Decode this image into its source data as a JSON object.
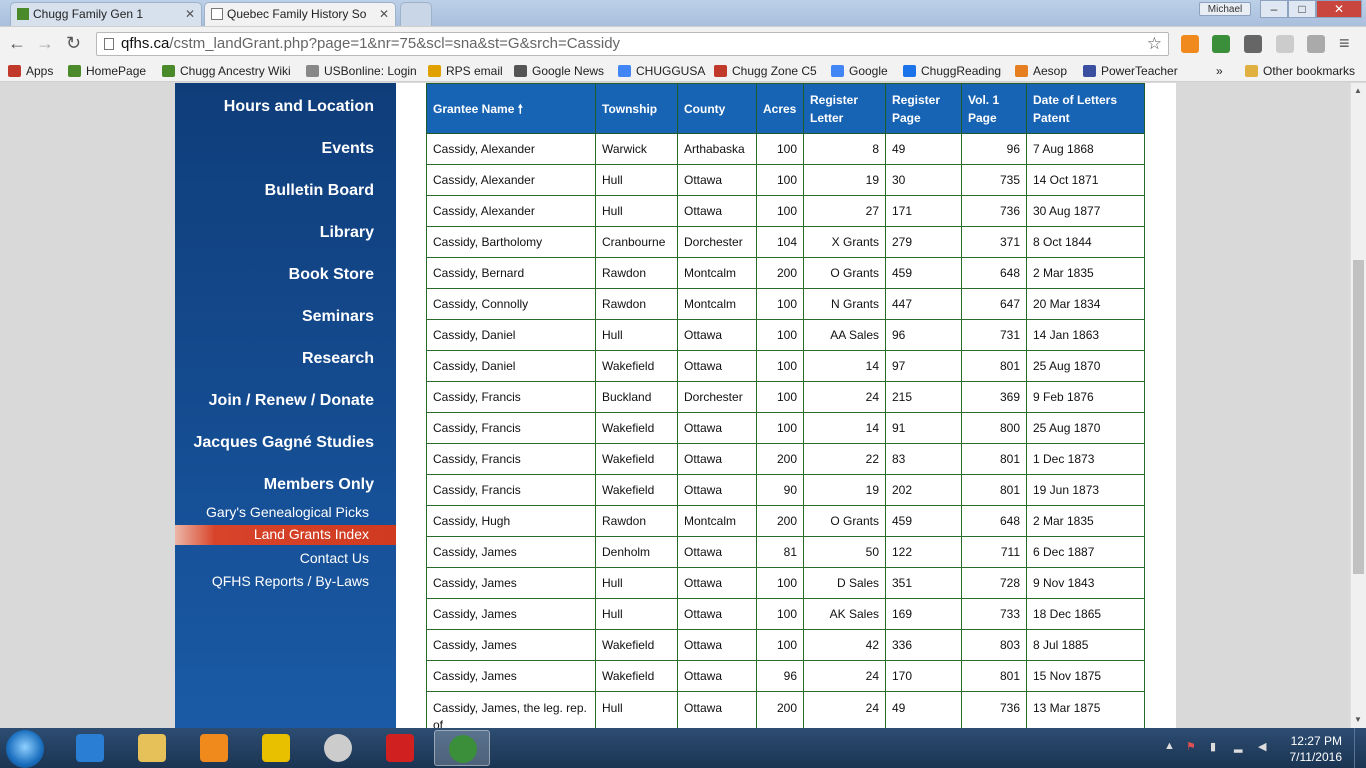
{
  "browser": {
    "tabs": [
      {
        "title": "Chugg Family Gen 1"
      },
      {
        "title": "Quebec Family History So"
      }
    ],
    "user": "Michael",
    "url_domain": "qfhs.ca",
    "url_path": "/cstm_landGrant.php?page=1&nr=75&scl=sna&st=G&srch=Cassidy",
    "bookmarks": [
      {
        "label": "Apps",
        "color": "#c0392b"
      },
      {
        "label": "HomePage",
        "color": "#4a8a2a"
      },
      {
        "label": "Chugg Ancestry Wiki",
        "color": "#4a8a2a"
      },
      {
        "label": "USBonline: Login",
        "color": "#888888"
      },
      {
        "label": "RPS email",
        "color": "#e0a000"
      },
      {
        "label": "Google News",
        "color": "#555555"
      },
      {
        "label": "CHUGGUSA",
        "color": "#4285f4"
      },
      {
        "label": "Chugg Zone C5",
        "color": "#c0392b"
      },
      {
        "label": "Google",
        "color": "#4285f4"
      },
      {
        "label": "ChuggReading",
        "color": "#1a73e8"
      },
      {
        "label": "Aesop",
        "color": "#e67e22"
      },
      {
        "label": "PowerTeacher",
        "color": "#3a4fa0"
      },
      {
        "label": "»",
        "color": ""
      },
      {
        "label": "Other bookmarks",
        "color": "#e0b040"
      }
    ]
  },
  "sidebar": {
    "main_items": [
      {
        "label": "Hours and Location"
      },
      {
        "label": "Events"
      },
      {
        "label": "Bulletin Board"
      },
      {
        "label": "Library"
      },
      {
        "label": "Book Store"
      },
      {
        "label": "Seminars"
      },
      {
        "label": "Research"
      },
      {
        "label": "Join / Renew / Donate"
      },
      {
        "label": "Jacques Gagné Studies"
      },
      {
        "label": "Members Only"
      }
    ],
    "sub_items": [
      {
        "label": "Gary's Genealogical Picks"
      },
      {
        "label": "Land Grants Index",
        "active": true
      },
      {
        "label": "Contact Us"
      },
      {
        "label": "QFHS Reports / By-Laws"
      }
    ]
  },
  "table": {
    "headers": [
      "Grantee Name",
      "Township",
      "County",
      "Acres",
      "Register Letter",
      "Register Page",
      "Vol. 1 Page",
      "Date of Letters Patent"
    ],
    "sort_indicator": "🠕",
    "rows": [
      [
        "Cassidy, Alexander",
        "Warwick",
        "Arthabaska",
        "100",
        "8",
        "49",
        "96",
        "7 Aug 1868"
      ],
      [
        "Cassidy, Alexander",
        "Hull",
        "Ottawa",
        "100",
        "19",
        "30",
        "735",
        "14 Oct 1871"
      ],
      [
        "Cassidy, Alexander",
        "Hull",
        "Ottawa",
        "100",
        "27",
        "171",
        "736",
        "30 Aug 1877"
      ],
      [
        "Cassidy, Bartholomy",
        "Cranbourne",
        "Dorchester",
        "104",
        "X Grants",
        "279",
        "371",
        "8 Oct 1844"
      ],
      [
        "Cassidy, Bernard",
        "Rawdon",
        "Montcalm",
        "200",
        "O Grants",
        "459",
        "648",
        "2 Mar 1835"
      ],
      [
        "Cassidy, Connolly",
        "Rawdon",
        "Montcalm",
        "100",
        "N Grants",
        "447",
        "647",
        "20 Mar 1834"
      ],
      [
        "Cassidy, Daniel",
        "Hull",
        "Ottawa",
        "100",
        "AA Sales",
        "96",
        "731",
        "14 Jan 1863"
      ],
      [
        "Cassidy, Daniel",
        "Wakefield",
        "Ottawa",
        "100",
        "14",
        "97",
        "801",
        "25 Aug 1870"
      ],
      [
        "Cassidy, Francis",
        "Buckland",
        "Dorchester",
        "100",
        "24",
        "215",
        "369",
        "9 Feb 1876"
      ],
      [
        "Cassidy, Francis",
        "Wakefield",
        "Ottawa",
        "100",
        "14",
        "91",
        "800",
        "25 Aug 1870"
      ],
      [
        "Cassidy, Francis",
        "Wakefield",
        "Ottawa",
        "200",
        "22",
        "83",
        "801",
        "1 Dec 1873"
      ],
      [
        "Cassidy, Francis",
        "Wakefield",
        "Ottawa",
        "90",
        "19",
        "202",
        "801",
        "19 Jun 1873"
      ],
      [
        "Cassidy, Hugh",
        "Rawdon",
        "Montcalm",
        "200",
        "O Grants",
        "459",
        "648",
        "2 Mar 1835"
      ],
      [
        "Cassidy, James",
        "Denholm",
        "Ottawa",
        "81",
        "50",
        "122",
        "711",
        "6 Dec 1887"
      ],
      [
        "Cassidy, James",
        "Hull",
        "Ottawa",
        "100",
        "D Sales",
        "351",
        "728",
        "9 Nov 1843"
      ],
      [
        "Cassidy, James",
        "Hull",
        "Ottawa",
        "100",
        "AK Sales",
        "169",
        "733",
        "18 Dec 1865"
      ],
      [
        "Cassidy, James",
        "Wakefield",
        "Ottawa",
        "100",
        "42",
        "336",
        "803",
        "8 Jul 1885"
      ],
      [
        "Cassidy, James",
        "Wakefield",
        "Ottawa",
        "96",
        "24",
        "170",
        "801",
        "15 Nov 1875"
      ],
      [
        "Cassidy, James, the leg. rep. of",
        "Hull",
        "Ottawa",
        "200",
        "24",
        "49",
        "736",
        "13 Mar 1875"
      ]
    ]
  },
  "taskbar": {
    "apps": [
      {
        "name": "internet-explorer",
        "color": "#2a7fd4"
      },
      {
        "name": "file-explorer",
        "color": "#e6c15a"
      },
      {
        "name": "media-player",
        "color": "#f08a1c"
      },
      {
        "name": "settings-gear",
        "color": "#e8c000"
      },
      {
        "name": "clock-app",
        "color": "#cccccc"
      },
      {
        "name": "pushpin-app",
        "color": "#d02020"
      },
      {
        "name": "chrome",
        "color": "#3b8f3b"
      }
    ],
    "time": "12:27 PM",
    "date": "7/11/2016"
  },
  "colors": {
    "header_blue": "#1763b4",
    "sidebar_blue": "#114a8f",
    "active_nav": "#cf3a20",
    "grid_border": "#2a6a2a"
  }
}
